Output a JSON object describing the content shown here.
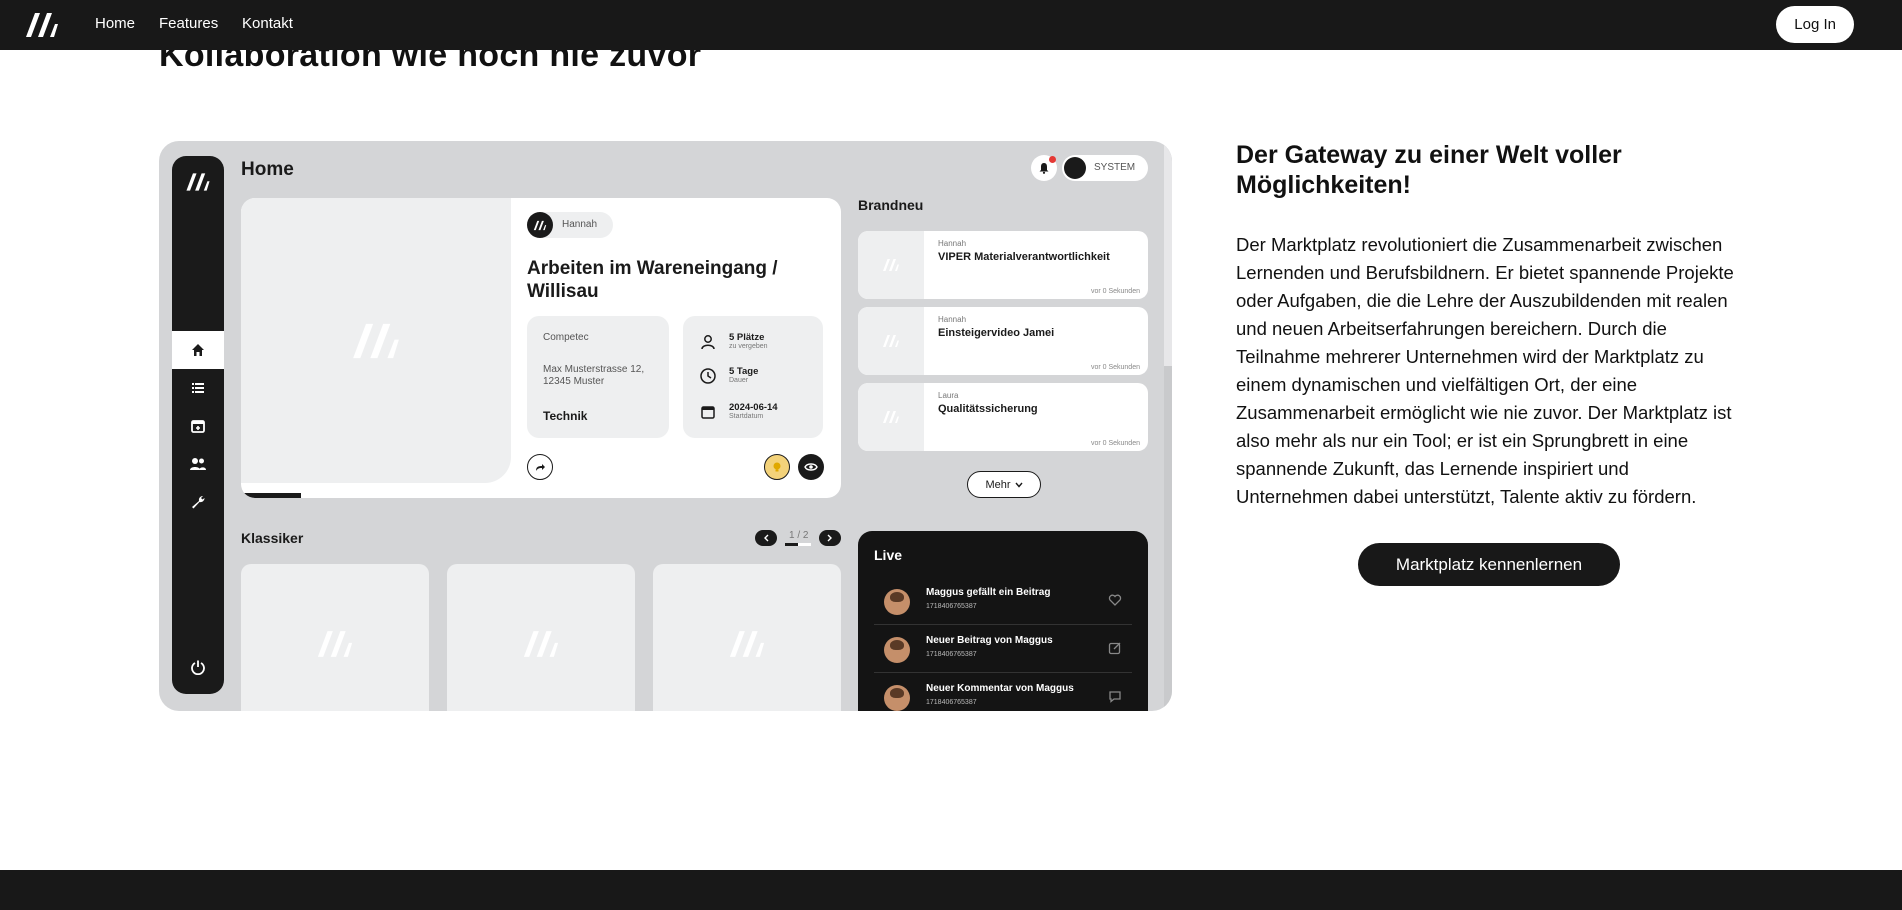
{
  "nav": {
    "logo_icon": "brand-logo-icon",
    "links": [
      "Home",
      "Features",
      "Kontakt"
    ],
    "login_label": "Log In"
  },
  "hero": {
    "headline": "Kollaboration wie noch nie zuvor"
  },
  "mockup": {
    "page_title": "Home",
    "user_label": "SYSTEM",
    "featured": {
      "author": "Hannah",
      "title": "Arbeiten im Wareneingang / Willisau",
      "company": "Competec",
      "address": "Max Musterstrasse 12, 12345 Muster",
      "category": "Technik",
      "stats": [
        {
          "main": "5 Plätze",
          "sub": "zu vergeben",
          "icon": "person-icon"
        },
        {
          "main": "5 Tage",
          "sub": "Dauer",
          "icon": "clock-icon"
        },
        {
          "main": "2024-06-14",
          "sub": "Startdatum",
          "icon": "calendar-icon"
        }
      ]
    },
    "brandneu": {
      "title": "Brandneu",
      "items": [
        {
          "author": "Hannah",
          "title": "VIPER Materialverantwortlichkeit",
          "time": "vor 0 Sekunden"
        },
        {
          "author": "Hannah",
          "title": "Einsteigervideo Jamei",
          "time": "vor 0 Sekunden"
        },
        {
          "author": "Laura",
          "title": "Qualitätssicherung",
          "time": "vor 0 Sekunden"
        }
      ],
      "more_label": "Mehr"
    },
    "klassiker": {
      "title": "Klassiker",
      "pager": "1 / 2"
    },
    "live": {
      "title": "Live",
      "items": [
        {
          "text": "Maggus gefällt ein Beitrag",
          "sub": "1718406765387",
          "icon": "heart-icon"
        },
        {
          "text": "Neuer Beitrag von Maggus",
          "sub": "1718406765387",
          "icon": "edit-icon"
        },
        {
          "text": "Neuer Kommentar von Maggus",
          "sub": "1718406765387",
          "icon": "comment-icon"
        }
      ]
    }
  },
  "side": {
    "title": "Der Gateway zu einer Welt voller Möglichkeiten!",
    "body": "Der Marktplatz revolutioniert die Zusammenarbeit zwischen Lernenden und Berufsbildnern. Er bietet spannende Projekte oder Aufgaben, die die Lehre der Auszubildenden mit realen und neuen Arbeitserfahrungen bereichern. Durch die Teilnahme mehrerer Unternehmen wird der Marktplatz zu einem dynamischen und vielfältigen Ort, der eine Zusammenarbeit ermöglicht wie nie zuvor. Der Marktplatz ist also mehr als nur ein Tool; er ist ein Sprungbrett in eine spannende Zukunft, das Lernende inspiriert und Unternehmen dabei unterstützt, Talente aktiv zu fördern.",
    "cta_label": "Marktplatz kennenlernen"
  },
  "colors": {
    "nav_bg": "#181818",
    "mock_bg": "#d4d5d7",
    "card_bg": "#ffffff",
    "placeholder_bg": "#eeeff0"
  }
}
